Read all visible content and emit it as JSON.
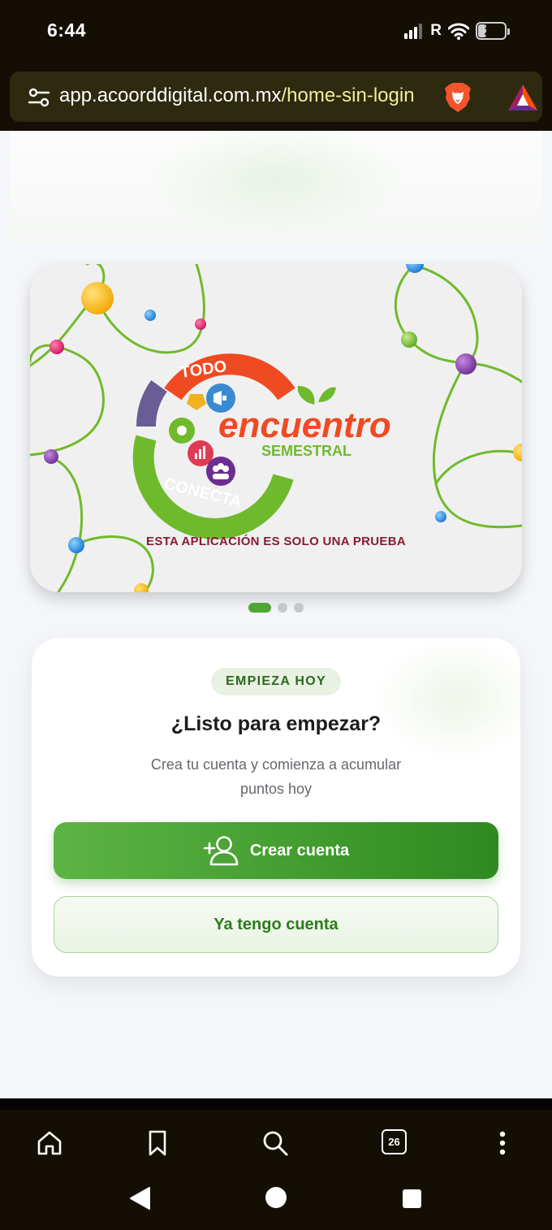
{
  "status_bar": {
    "time": "6:44",
    "network_mark": "R",
    "battery": "28"
  },
  "url_bar": {
    "domain": "app.acoorddigital.com.mx",
    "path": "/home-sin-login",
    "site_settings_icon": "tune-icon",
    "shields_icon": "brave-lion-icon",
    "rewards_icon": "bat-triangle-icon"
  },
  "banner": {
    "logo_top_arc": "TODO",
    "logo_bottom_arc": "CONECTA",
    "logo_word": "encuentro",
    "logo_subword": "SEMESTRAL",
    "disclaimer": "ESTA APLICACIÓN ES SOLO UNA PRUEBA",
    "slides_total": 3,
    "active_slide": 1
  },
  "cta": {
    "badge": "EMPIEZA HOY",
    "title": "¿Listo para empezar?",
    "subtitle": "Crea tu cuenta y comienza a acumular puntos hoy",
    "create_button": "Crear cuenta",
    "create_icon": "add-user-icon",
    "login_button": "Ya tengo cuenta"
  },
  "browser_toolbar": {
    "tabs_count": "26",
    "icons": [
      "home-icon",
      "bookmark-icon",
      "search-icon",
      "tabs-icon",
      "more-vert-icon"
    ]
  },
  "colors": {
    "brand_green": "#4ea634",
    "brand_green_dark": "#2e8a1f",
    "logo_orange": "#f04a23",
    "disclaimer_red": "#8a1a34",
    "chrome_bg": "#130f04"
  }
}
